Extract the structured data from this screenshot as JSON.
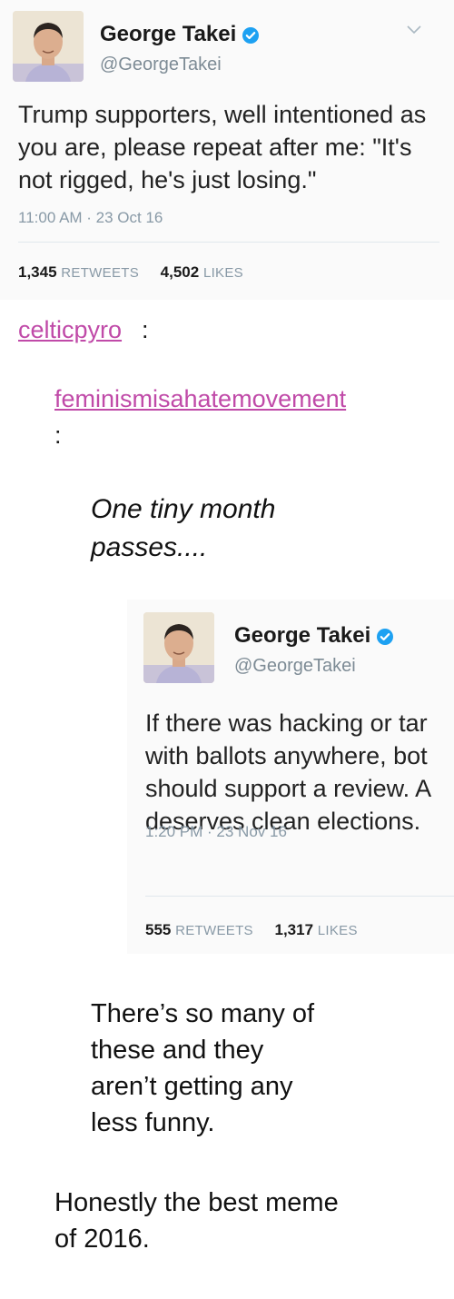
{
  "tweet1": {
    "name": "George Takei",
    "handle": "@GeorgeTakei",
    "text_lines": [
      "Trump supporters, well intentioned as",
      "you are, please repeat after me:  \"It's",
      "not rigged, he's just losing.\""
    ],
    "timestamp": "11:00 AM · 23 Oct 16",
    "retweets_count": "1,345",
    "retweets_label": "RETWEETS",
    "likes_count": "4,502",
    "likes_label": "LIKES"
  },
  "post": {
    "user1": "celticpyro",
    "user1_colon": ":",
    "user2": "feminismisahatemovement",
    "user2_colon": ":",
    "italic_lines": [
      "One tiny month",
      "passes...."
    ],
    "reply_lines": [
      "There’s so many of",
      "these and they",
      "aren’t getting any",
      "less funny."
    ],
    "final_lines": [
      "Honestly the best meme",
      "of 2016."
    ]
  },
  "tweet2": {
    "name": "George Takei",
    "handle": "@GeorgeTakei",
    "text_lines": [
      "If there was hacking or tar",
      "with ballots anywhere, bot",
      "should support a review. A",
      "deserves clean elections."
    ],
    "timestamp": "1:20 PM · 23 Nov 16",
    "retweets_count": "555",
    "retweets_label": "RETWEETS",
    "likes_count": "1,317",
    "likes_label": "LIKES"
  },
  "colors": {
    "link": "#c04aa8",
    "verified": "#1da1f2",
    "muted": "#8899a6"
  },
  "icons": [
    "verified-badge-icon",
    "chevron-down-icon",
    "avatar-photo"
  ]
}
